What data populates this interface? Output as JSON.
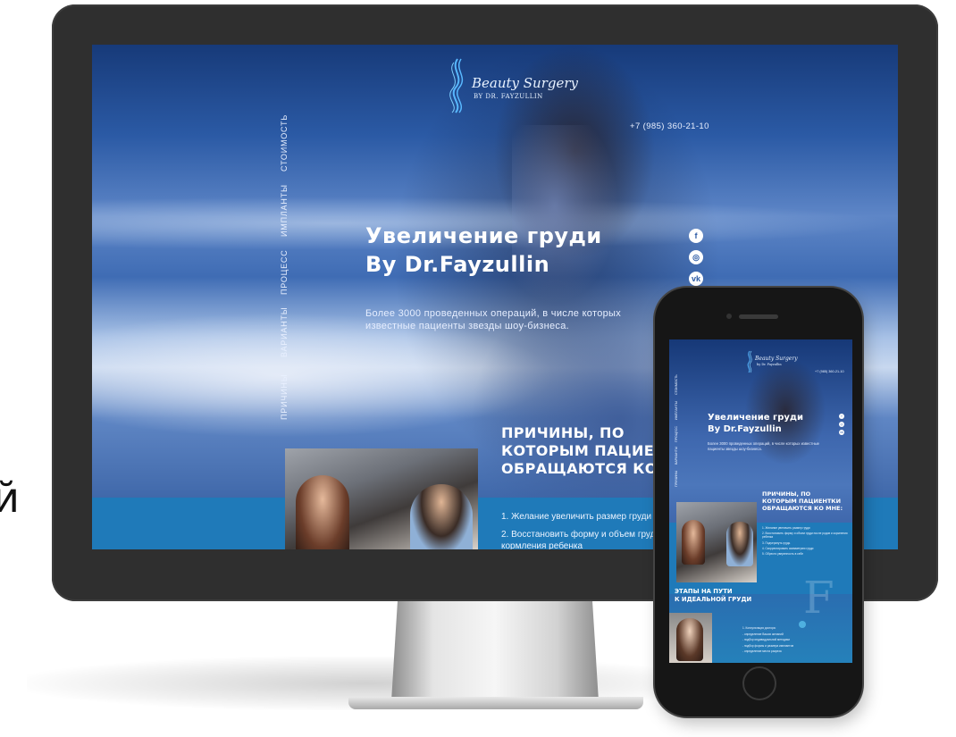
{
  "stray_text": "й",
  "desktop": {
    "brand": {
      "line1": "Beauty Surgery",
      "line2": "BY DR. FAYZULLIN"
    },
    "phone": "+7 (985) 360-21-10",
    "nav": [
      "ПРИЧИНЫ",
      "ВАРИАНТЫ",
      "ПРОЦЕСС",
      "ИМПЛАНТЫ",
      "СТОИМОСТЬ"
    ],
    "hero": {
      "title_line1": "Увеличение груди",
      "title_line2": "By Dr.Fayzullin",
      "subtitle": "Более 3000 проведенных операций, в числе которых известные пациенты звезды шоу-бизнеса."
    },
    "social": [
      "f",
      "◎",
      "vk"
    ],
    "reasons": {
      "title_line1": "ПРИЧИНЫ, ПО",
      "title_line2": "КОТОРЫМ ПАЦИЕНТКИ",
      "title_line3": "ОБРАЩАЮТСЯ КО МНЕ:",
      "items": [
        "1. Желание увеличить размер груди",
        "2. Восстановить форму и объем груди после родов и кормления ребенка"
      ]
    }
  },
  "mobile": {
    "brand": {
      "line1": "Beauty Surgery",
      "line2": "by Dr. Fayzullin"
    },
    "phone": "+7 (985) 360-21-10",
    "nav": [
      "ПРИЧИНЫ",
      "ВАРИАНТЫ",
      "ПРОЦЕСС",
      "ИМПЛАНТЫ",
      "СТОИМОСТЬ"
    ],
    "hero": {
      "title_line1": "Увеличение груди",
      "title_line2": "By Dr.Fayzullin",
      "subtitle": "Более 3000 проведенных операций, в числе которых известные пациенты звезды шоу-бизнеса."
    },
    "social": [
      "f",
      "◎",
      "vk"
    ],
    "reasons": {
      "title_line1": "ПРИЧИНЫ, ПО",
      "title_line2": "КОТОРЫМ ПАЦИЕНТКИ",
      "title_line3": "ОБРАЩАЮТСЯ КО МНЕ:",
      "items": [
        "1. Желание увеличить размер груди",
        "2. Восстановить форму и объем груди после родов и кормления ребенка",
        "3. Подчеркнуть грудь",
        "4. Скорректировать асимметрию груди",
        "5. Обрести уверенность в себе"
      ]
    },
    "stages": {
      "title_line1": "ЭТАПЫ НА ПУТИ",
      "title_line2": "К ИДЕАЛЬНОЙ ГРУДИ",
      "letter": "F",
      "items": [
        "1. Консультация доктора:",
        "- определение Ваших желаний",
        "- подбор индивидуальной методики",
        "- подбор формы и размера имплантов",
        "- определение места разреза"
      ]
    }
  }
}
